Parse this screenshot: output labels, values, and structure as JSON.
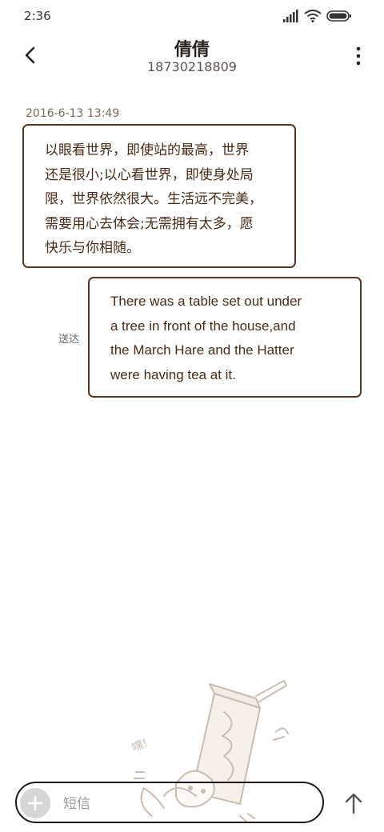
{
  "status_bar": {
    "time": "2:36",
    "icons": [
      "signal-icon",
      "wifi-icon",
      "battery-icon"
    ]
  },
  "header": {
    "contact_name": "倩倩",
    "contact_number": "18730218809",
    "back_icon": "chevron-left-icon",
    "more_icon": "more-vertical-icon"
  },
  "conversation": {
    "timestamp": "2016-6-13 13:49",
    "received_message": {
      "lines": [
        "以眼看世界，即使站的最高，世界",
        "还是很小;以心看世界，即使身处局",
        "限，世界依然很大。生活远不完美，",
        "需要用心去体会;无需拥有太多，愿",
        "快乐与你相随。"
      ]
    },
    "sent_message": {
      "lines": [
        "There was a table set out under",
        "a tree in front of the house,and",
        "the March Hare and the Hatter",
        "were having tea at it."
      ],
      "status": "送达"
    }
  },
  "composer": {
    "placeholder": "短信",
    "add_icon": "plus-icon",
    "send_icon": "arrow-up-icon"
  },
  "colors": {
    "bubble_border": "#5a3622",
    "bubble_text": "#4a2a18",
    "timestamp": "#7a6a5a",
    "background": "#ffffff"
  }
}
